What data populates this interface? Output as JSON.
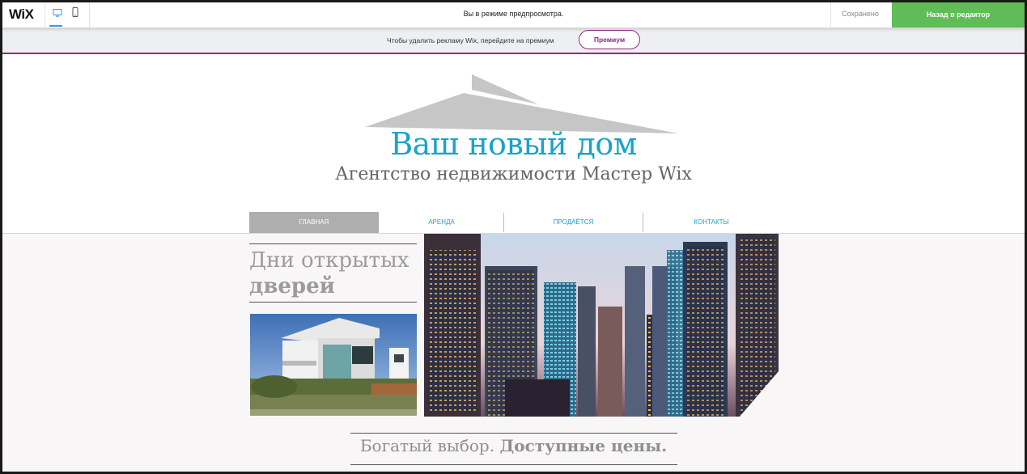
{
  "topbar": {
    "logo": "WiX",
    "preview_message": "Вы в режиме предпросмотра.",
    "saved_status": "Сохранено",
    "back_button": "Назад в редактор",
    "device_buttons": [
      "desktop-icon",
      "mobile-icon"
    ],
    "accent_color": "#60bc57"
  },
  "promo": {
    "text": "Чтобы удалить рекламу Wix, перейдите на премиум",
    "button": "Премиум",
    "accent_color": "#8e2a82"
  },
  "site": {
    "title": "Ваш новый дом",
    "subtitle": "Агентство недвижимости Мастер Wix",
    "title_color": "#1aa3c9",
    "nav": [
      {
        "label": "ГЛАВНАЯ",
        "active": true
      },
      {
        "label": "АРЕНДА",
        "active": false
      },
      {
        "label": "ПРОДАЁТСЯ",
        "active": false
      },
      {
        "label": "КОНТАКТЫ",
        "active": false
      }
    ],
    "open_house": {
      "line1": "Дни открытых",
      "line2": "дверей"
    },
    "tagline": {
      "regular": "Богатый выбор. ",
      "bold": "Доступные цены."
    }
  }
}
